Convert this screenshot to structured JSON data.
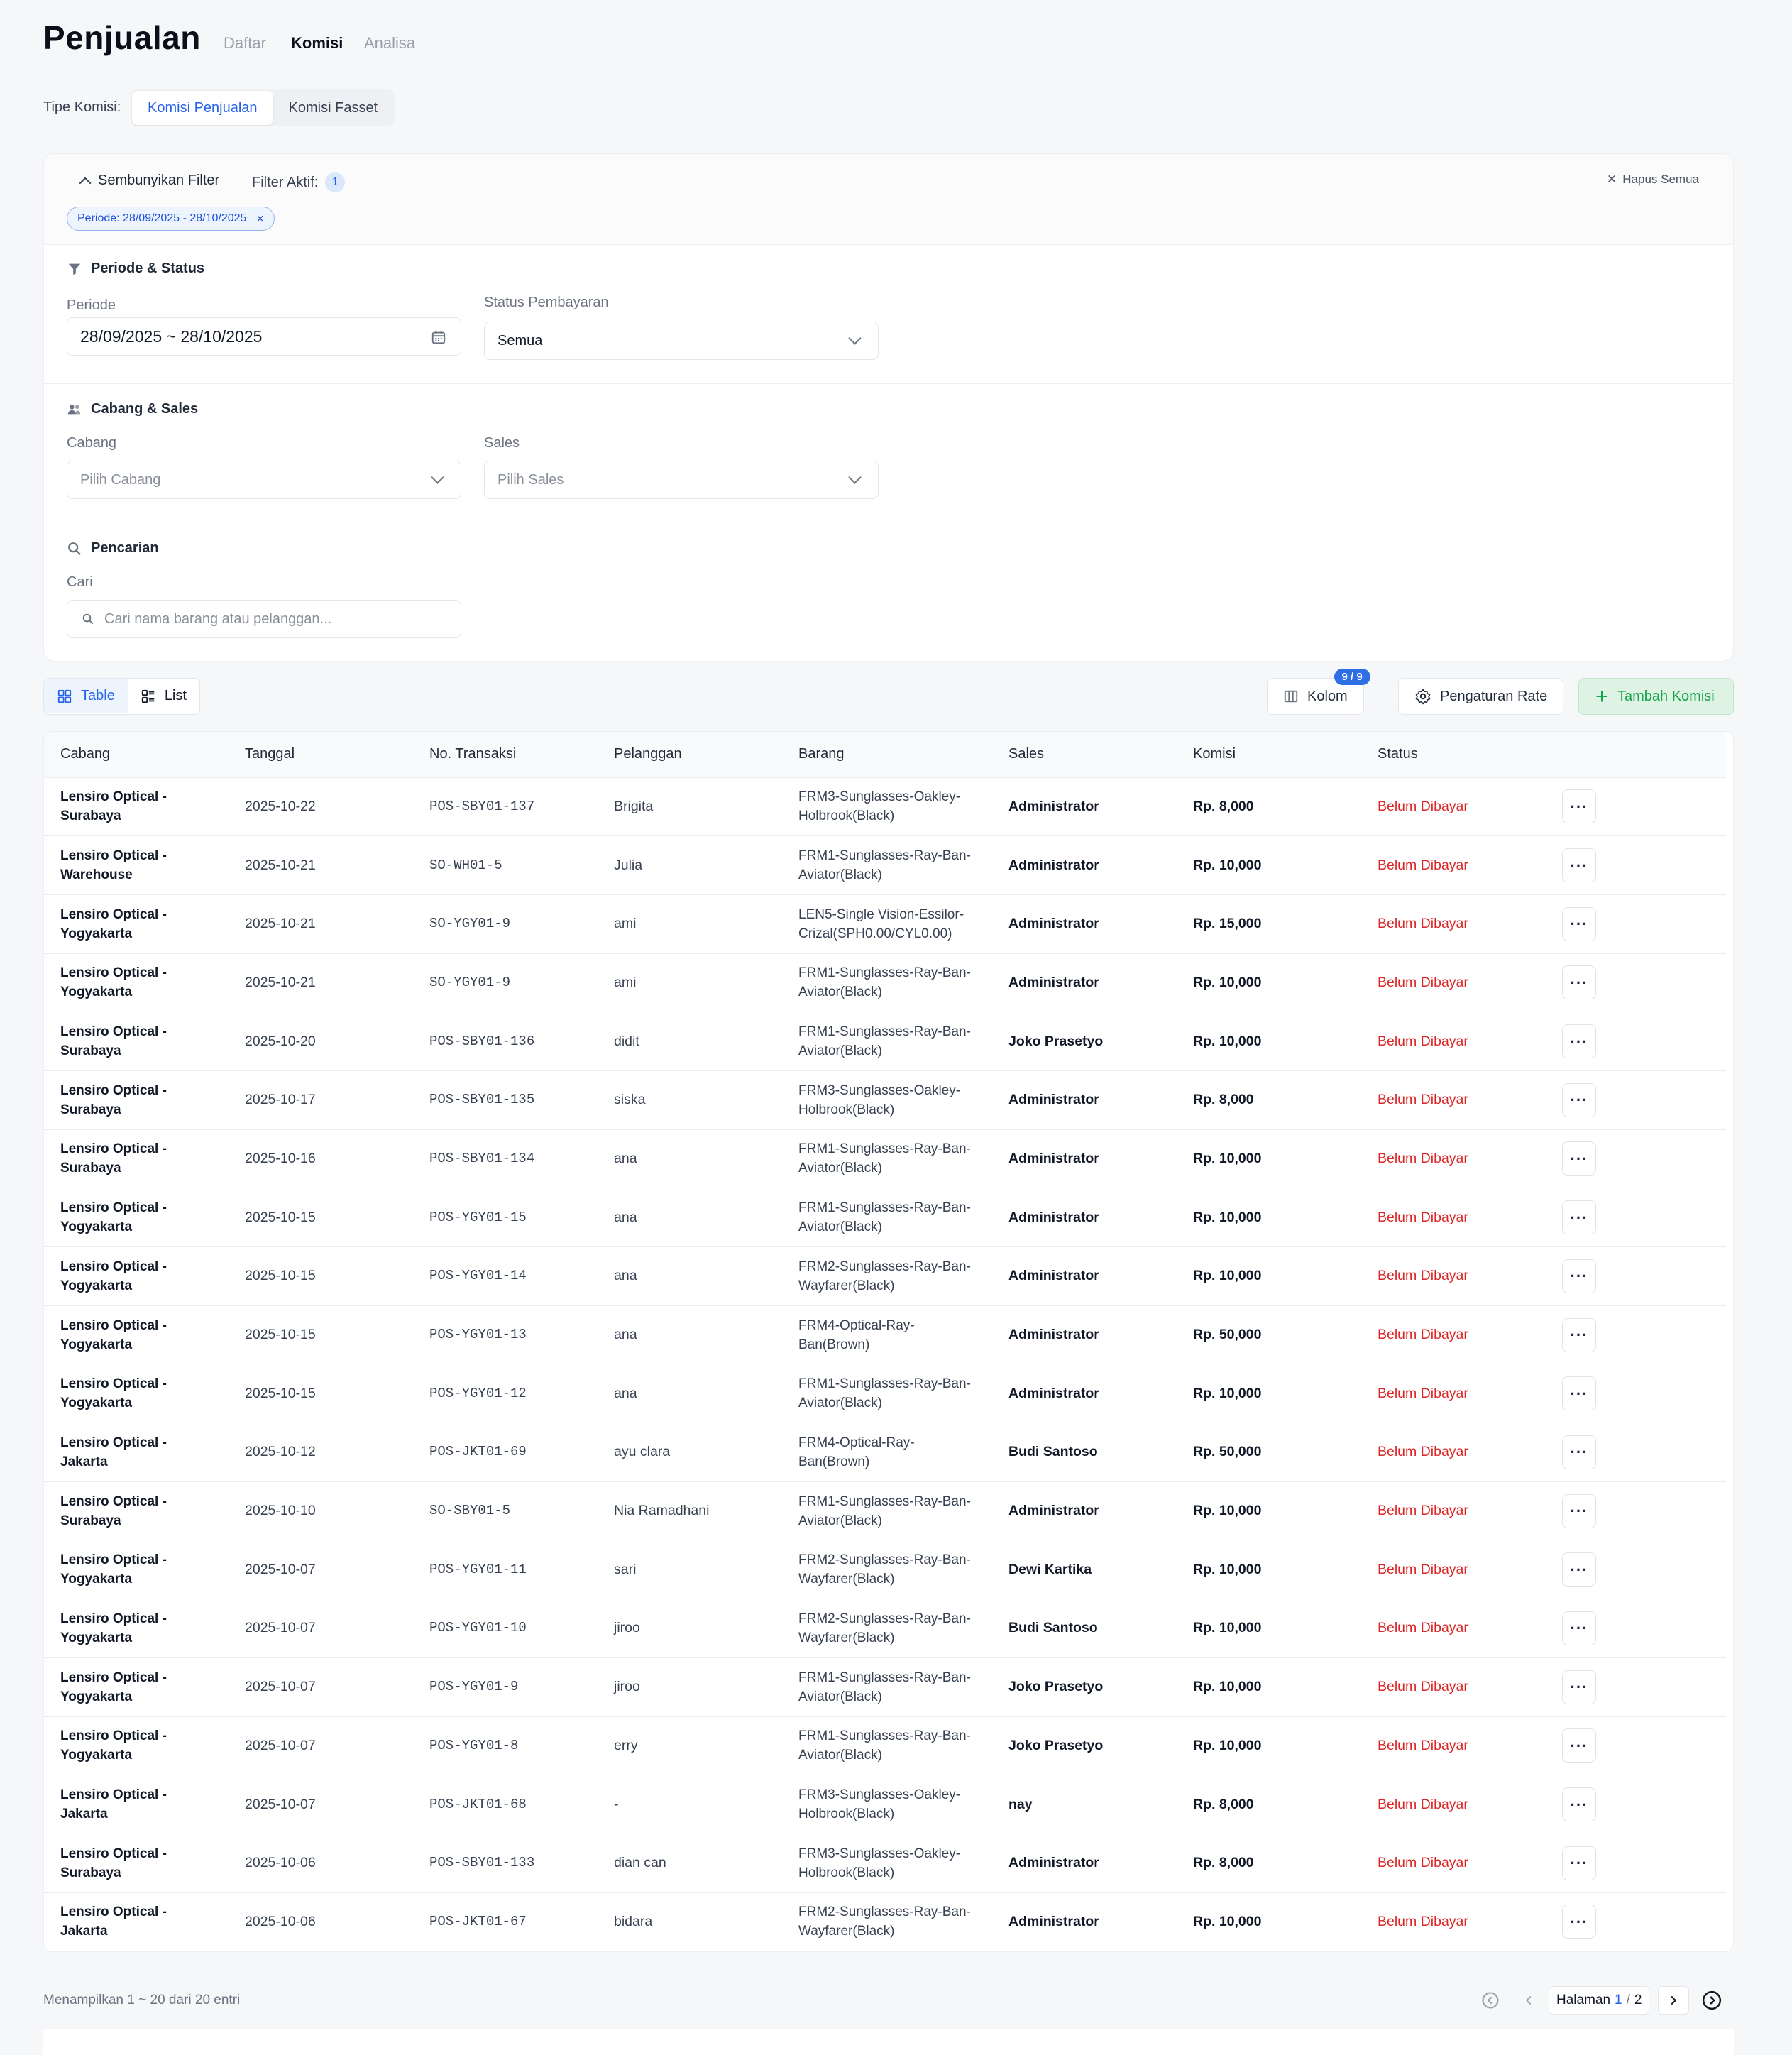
{
  "header": {
    "title": "Penjualan",
    "tabs": [
      {
        "label": "Daftar",
        "active": false
      },
      {
        "label": "Komisi",
        "active": true
      },
      {
        "label": "Analisa",
        "active": false
      }
    ]
  },
  "tipe_komisi": {
    "label": "Tipe Komisi:",
    "options": [
      {
        "label": "Komisi Penjualan",
        "active": true
      },
      {
        "label": "Komisi Fasset",
        "active": false
      }
    ]
  },
  "filter": {
    "hide_label": "Sembunyikan Filter",
    "active_label": "Filter Aktif:",
    "active_count": "1",
    "clear_all": "Hapus Semua",
    "chip_label": "Periode:",
    "chip_value": "28/09/2025 - 28/10/2025",
    "sections": {
      "periode_status": "Periode & Status",
      "cabang_sales": "Cabang & Sales",
      "pencarian": "Pencarian"
    },
    "fields": {
      "periode_label": "Periode",
      "periode_value": "28/09/2025 ~ 28/10/2025",
      "status_label": "Status Pembayaran",
      "status_value": "Semua",
      "cabang_label": "Cabang",
      "cabang_placeholder": "Pilih Cabang",
      "sales_label": "Sales",
      "sales_placeholder": "Pilih Sales",
      "cari_label": "Cari",
      "cari_placeholder": "Cari nama barang atau pelanggan..."
    }
  },
  "toolbar": {
    "view_table": "Table",
    "view_list": "List",
    "kolom_label": "Kolom",
    "kolom_badge": "9 / 9",
    "rate_label": "Pengaturan Rate",
    "add_label": "Tambah Komisi"
  },
  "table": {
    "columns": [
      "Cabang",
      "Tanggal",
      "No. Transaksi",
      "Pelanggan",
      "Barang",
      "Sales",
      "Komisi",
      "Status",
      ""
    ],
    "rows": [
      [
        "Lensiro Optical - Surabaya",
        "2025-10-22",
        "POS-SBY01-137",
        "Brigita",
        "FRM3-Sunglasses-Oakley-Holbrook(Black)",
        "Administrator",
        "Rp. 8,000",
        "Belum Dibayar"
      ],
      [
        "Lensiro Optical - Warehouse",
        "2025-10-21",
        "SO-WH01-5",
        "Julia",
        "FRM1-Sunglasses-Ray-Ban-Aviator(Black)",
        "Administrator",
        "Rp. 10,000",
        "Belum Dibayar"
      ],
      [
        "Lensiro Optical - Yogyakarta",
        "2025-10-21",
        "SO-YGY01-9",
        "ami",
        "LEN5-Single Vision-Essilor-Crizal(SPH0.00/CYL0.00)",
        "Administrator",
        "Rp. 15,000",
        "Belum Dibayar"
      ],
      [
        "Lensiro Optical - Yogyakarta",
        "2025-10-21",
        "SO-YGY01-9",
        "ami",
        "FRM1-Sunglasses-Ray-Ban-Aviator(Black)",
        "Administrator",
        "Rp. 10,000",
        "Belum Dibayar"
      ],
      [
        "Lensiro Optical - Surabaya",
        "2025-10-20",
        "POS-SBY01-136",
        "didit",
        "FRM1-Sunglasses-Ray-Ban-Aviator(Black)",
        "Joko Prasetyo",
        "Rp. 10,000",
        "Belum Dibayar"
      ],
      [
        "Lensiro Optical - Surabaya",
        "2025-10-17",
        "POS-SBY01-135",
        "siska",
        "FRM3-Sunglasses-Oakley-Holbrook(Black)",
        "Administrator",
        "Rp. 8,000",
        "Belum Dibayar"
      ],
      [
        "Lensiro Optical - Surabaya",
        "2025-10-16",
        "POS-SBY01-134",
        "ana",
        "FRM1-Sunglasses-Ray-Ban-Aviator(Black)",
        "Administrator",
        "Rp. 10,000",
        "Belum Dibayar"
      ],
      [
        "Lensiro Optical - Yogyakarta",
        "2025-10-15",
        "POS-YGY01-15",
        "ana",
        "FRM1-Sunglasses-Ray-Ban-Aviator(Black)",
        "Administrator",
        "Rp. 10,000",
        "Belum Dibayar"
      ],
      [
        "Lensiro Optical - Yogyakarta",
        "2025-10-15",
        "POS-YGY01-14",
        "ana",
        "FRM2-Sunglasses-Ray-Ban-Wayfarer(Black)",
        "Administrator",
        "Rp. 10,000",
        "Belum Dibayar"
      ],
      [
        "Lensiro Optical - Yogyakarta",
        "2025-10-15",
        "POS-YGY01-13",
        "ana",
        "FRM4-Optical-Ray-Ban(Brown)",
        "Administrator",
        "Rp. 50,000",
        "Belum Dibayar"
      ],
      [
        "Lensiro Optical - Yogyakarta",
        "2025-10-15",
        "POS-YGY01-12",
        "ana",
        "FRM1-Sunglasses-Ray-Ban-Aviator(Black)",
        "Administrator",
        "Rp. 10,000",
        "Belum Dibayar"
      ],
      [
        "Lensiro Optical - Jakarta",
        "2025-10-12",
        "POS-JKT01-69",
        "ayu clara",
        "FRM4-Optical-Ray-Ban(Brown)",
        "Budi Santoso",
        "Rp. 50,000",
        "Belum Dibayar"
      ],
      [
        "Lensiro Optical - Surabaya",
        "2025-10-10",
        "SO-SBY01-5",
        "Nia Ramadhani",
        "FRM1-Sunglasses-Ray-Ban-Aviator(Black)",
        "Administrator",
        "Rp. 10,000",
        "Belum Dibayar"
      ],
      [
        "Lensiro Optical - Yogyakarta",
        "2025-10-07",
        "POS-YGY01-11",
        "sari",
        "FRM2-Sunglasses-Ray-Ban-Wayfarer(Black)",
        "Dewi Kartika",
        "Rp. 10,000",
        "Belum Dibayar"
      ],
      [
        "Lensiro Optical - Yogyakarta",
        "2025-10-07",
        "POS-YGY01-10",
        "jiroo",
        "FRM2-Sunglasses-Ray-Ban-Wayfarer(Black)",
        "Budi Santoso",
        "Rp. 10,000",
        "Belum Dibayar"
      ],
      [
        "Lensiro Optical - Yogyakarta",
        "2025-10-07",
        "POS-YGY01-9",
        "jiroo",
        "FRM1-Sunglasses-Ray-Ban-Aviator(Black)",
        "Joko Prasetyo",
        "Rp. 10,000",
        "Belum Dibayar"
      ],
      [
        "Lensiro Optical - Yogyakarta",
        "2025-10-07",
        "POS-YGY01-8",
        "erry",
        "FRM1-Sunglasses-Ray-Ban-Aviator(Black)",
        "Joko Prasetyo",
        "Rp. 10,000",
        "Belum Dibayar"
      ],
      [
        "Lensiro Optical - Jakarta",
        "2025-10-07",
        "POS-JKT01-68",
        "-",
        "FRM3-Sunglasses-Oakley-Holbrook(Black)",
        "nay",
        "Rp. 8,000",
        "Belum Dibayar"
      ],
      [
        "Lensiro Optical - Surabaya",
        "2025-10-06",
        "POS-SBY01-133",
        "dian can",
        "FRM3-Sunglasses-Oakley-Holbrook(Black)",
        "Administrator",
        "Rp. 8,000",
        "Belum Dibayar"
      ],
      [
        "Lensiro Optical - Jakarta",
        "2025-10-06",
        "POS-JKT01-67",
        "bidara",
        "FRM2-Sunglasses-Ray-Ban-Wayfarer(Black)",
        "Administrator",
        "Rp. 10,000",
        "Belum Dibayar"
      ]
    ],
    "row_action_icon": "more-horizontal-icon"
  },
  "footer": {
    "summary": "Menampilkan 1 ~ 20 dari 20 entri",
    "page_label": "Halaman",
    "page_current": "1",
    "page_sep": "/",
    "page_total": "2"
  },
  "colors": {
    "accent": "#2563eb",
    "status_unpaid": "#dc2626",
    "add_button": "#16a34a"
  }
}
